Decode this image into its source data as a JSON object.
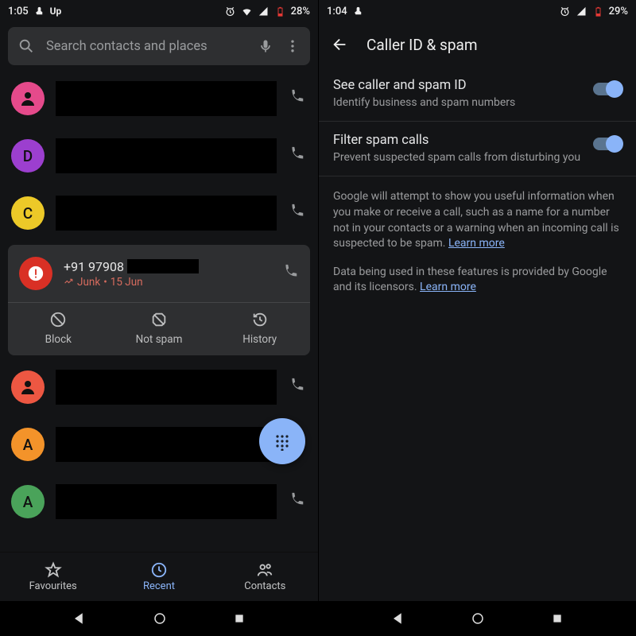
{
  "left": {
    "status": {
      "time": "1:05",
      "battery": "28%"
    },
    "search": {
      "placeholder": "Search contacts and places"
    },
    "calls": [
      {
        "avatarType": "person",
        "avatarBg": "#e54a8b"
      },
      {
        "avatarType": "letter",
        "avatarLetter": "D",
        "avatarBg": "#9c3fcf"
      },
      {
        "avatarType": "letter",
        "avatarLetter": "C",
        "avatarBg": "#ecc928"
      }
    ],
    "spam": {
      "number": "+91 97908",
      "subPrefix": "Junk",
      "subDate": "15 Jun",
      "actions": {
        "block": "Block",
        "notspam": "Not spam",
        "history": "History"
      }
    },
    "callsBelow": [
      {
        "avatarType": "person",
        "avatarBg": "#ed5742"
      },
      {
        "avatarType": "letter",
        "avatarLetter": "A",
        "avatarBg": "#f3932a"
      },
      {
        "avatarType": "letter",
        "avatarLetter": "A",
        "avatarBg": "#4aa35a"
      }
    ],
    "nav": {
      "fav": "Favourites",
      "recent": "Recent",
      "contacts": "Contacts"
    }
  },
  "right": {
    "status": {
      "time": "1:04",
      "battery": "29%"
    },
    "header": "Caller ID & spam",
    "setting1": {
      "title": "See caller and spam ID",
      "sub": "Identify business and spam numbers"
    },
    "setting2": {
      "title": "Filter spam calls",
      "sub": "Prevent suspected spam calls from disturbing you"
    },
    "info1a": "Google will attempt to show you useful information when you make or receive a call, such as a name for a number not in your contacts or a warning when an incoming call is suspected to be spam. ",
    "info1b": "Learn more",
    "info2a": "Data being used in these features is provided by Google and its licensors. ",
    "info2b": "Learn more"
  }
}
